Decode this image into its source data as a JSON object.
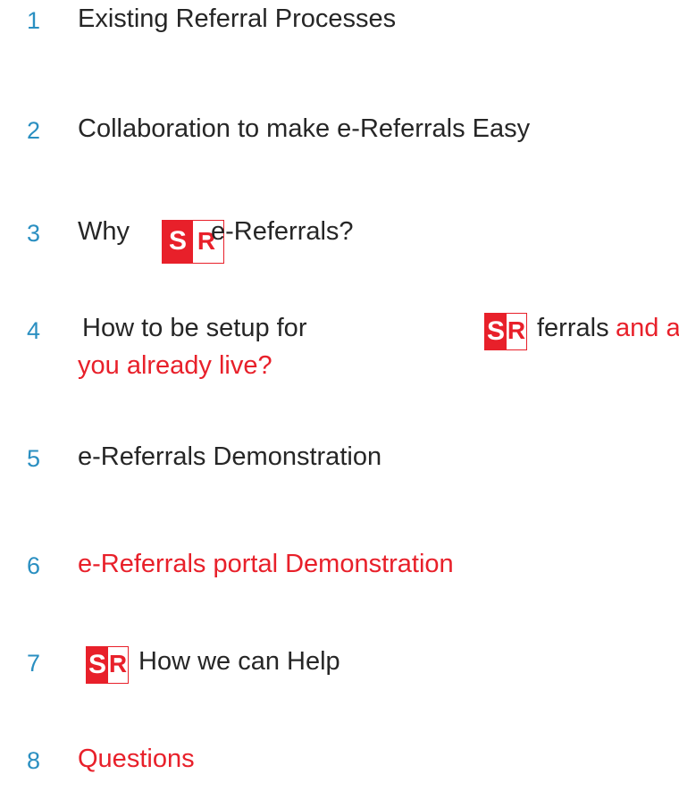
{
  "logo": {
    "s": "S",
    "r": "R",
    "brand_red": "#e8202a"
  },
  "number_color": "#2a8fc1",
  "items": [
    {
      "number": "1",
      "label": "Existing Referral Processes"
    },
    {
      "number": "2",
      "label": "Collaboration to make e-Referrals Easy"
    },
    {
      "number": "3",
      "label_before": "Why",
      "label_after": "e-Referrals?"
    },
    {
      "number": "4",
      "label_before": "How to be setup for",
      "label_after": "ferrals",
      "label_red_1": "and are",
      "label_red_2": "you already live?"
    },
    {
      "number": "5",
      "label": "e-Referrals Demonstration"
    },
    {
      "number": "6",
      "label": "e-Referrals portal Demonstration"
    },
    {
      "number": "7",
      "label": "How we can Help"
    },
    {
      "number": "8",
      "label": "Questions"
    }
  ]
}
